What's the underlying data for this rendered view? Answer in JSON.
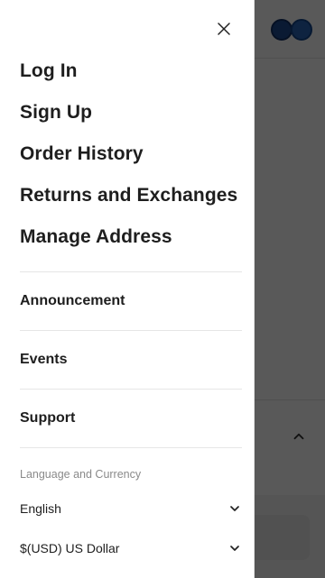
{
  "drawer": {
    "main_nav": [
      {
        "label": "Log In"
      },
      {
        "label": "Sign Up"
      },
      {
        "label": "Order History"
      },
      {
        "label": "Returns and Exchanges"
      },
      {
        "label": "Manage Address"
      }
    ],
    "secondary_nav": [
      {
        "label": "Announcement"
      },
      {
        "label": "Events"
      },
      {
        "label": "Support"
      }
    ],
    "language_currency_label": "Language and Currency",
    "language_value": "English",
    "currency_value": "$(USD) US Dollar"
  },
  "colors": {
    "overlay": "#000000a6",
    "text_primary": "#1e1e1e",
    "text_muted": "#8a8a8a",
    "divider": "#e6e6e6"
  },
  "icons": {
    "close": "close-icon",
    "chevron_down": "chevron-down-icon",
    "chevron_up": "chevron-up-icon",
    "globe": "globe-icon"
  }
}
